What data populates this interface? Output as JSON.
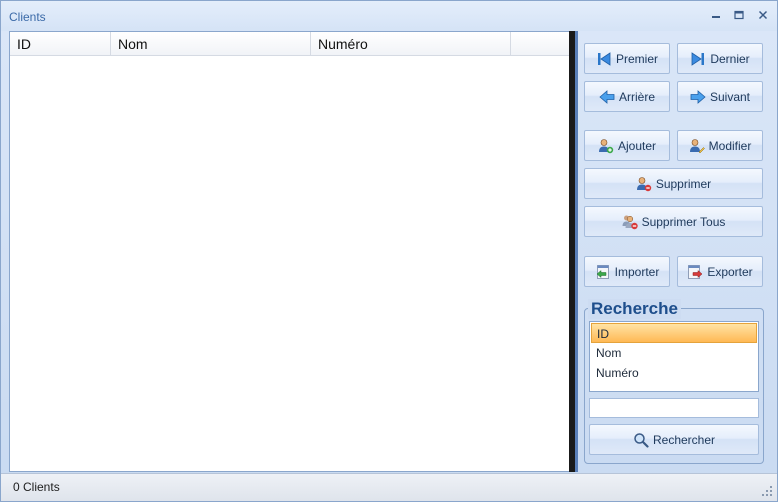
{
  "window": {
    "title": "Clients"
  },
  "grid": {
    "columns": [
      "ID",
      "Nom",
      "Numéro"
    ],
    "rows": []
  },
  "nav": {
    "first": "Premier",
    "last": "Dernier",
    "prev": "Arrière",
    "next": "Suivant"
  },
  "actions": {
    "add": "Ajouter",
    "edit": "Modifier",
    "delete": "Supprimer",
    "delete_all": "Supprimer Tous",
    "import": "Importer",
    "export": "Exporter"
  },
  "search": {
    "title": "Recherche",
    "fields": [
      "ID",
      "Nom",
      "Numéro"
    ],
    "selected_field": "ID",
    "query": "",
    "button": "Rechercher"
  },
  "status": {
    "text": "0 Clients"
  },
  "icons": {
    "first": "skip-first-icon",
    "last": "skip-last-icon",
    "prev": "arrow-left-icon",
    "next": "arrow-right-icon",
    "add": "user-add-icon",
    "edit": "user-edit-icon",
    "delete": "user-delete-icon",
    "delete_all": "users-delete-icon",
    "import": "import-icon",
    "export": "export-icon",
    "search": "magnifier-icon"
  },
  "colors": {
    "accent": "#3b6aa8",
    "selection": "#ffb955",
    "frame": "#c9daf1"
  }
}
